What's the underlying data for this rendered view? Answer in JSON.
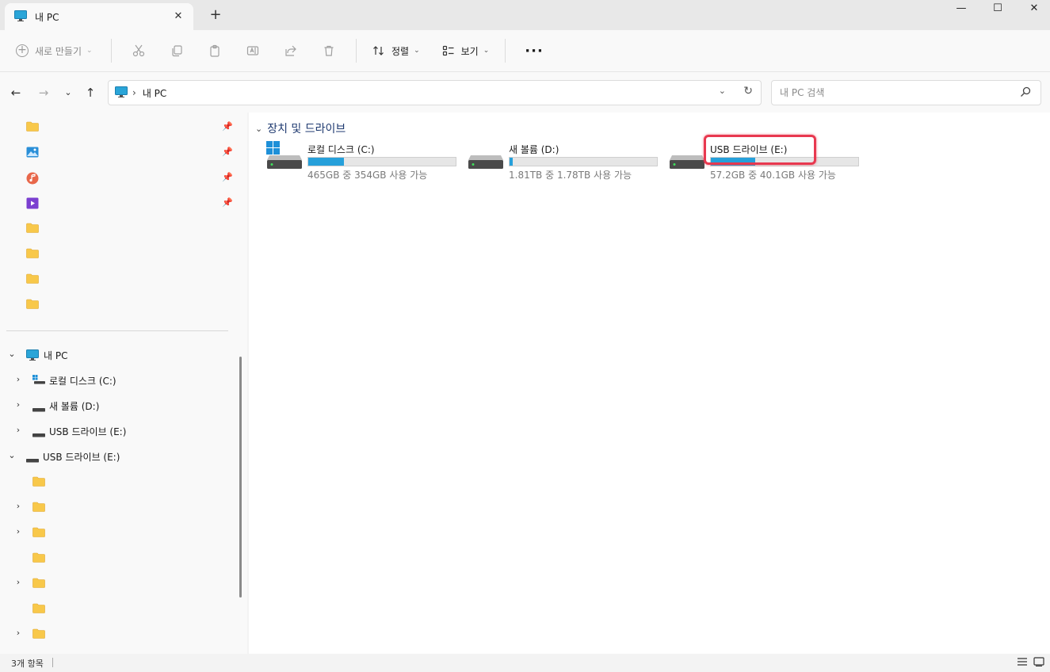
{
  "tab": {
    "title": "내 PC",
    "close_glyph": "✕",
    "new_tab_glyph": "+"
  },
  "window_controls": {
    "minimize": "—",
    "maximize": "☐",
    "close": "✕"
  },
  "toolbar": {
    "new_label": "새로 만들기",
    "sort_label": "정렬",
    "view_label": "보기",
    "more_label": "···"
  },
  "address": {
    "crumb": "내 PC",
    "search_placeholder": "내 PC 검색"
  },
  "sidebar": {
    "tree": {
      "this_pc": "내 PC",
      "local_disk_c": "로컬 디스크 (C:)",
      "new_volume_d": "새 볼륨 (D:)",
      "usb_e_child": "USB 드라이브 (E:)",
      "usb_e_root": "USB 드라이브 (E:)"
    }
  },
  "content": {
    "group_title": "장치 및 드라이브",
    "drives": [
      {
        "name": "로컬 디스크 (C:)",
        "free_text": "465GB 중 354GB 사용 가능",
        "used_fraction": 0.24
      },
      {
        "name": "새 볼륨 (D:)",
        "free_text": "1.81TB 중 1.78TB 사용 가능",
        "used_fraction": 0.02
      },
      {
        "name": "USB 드라이브 (E:)",
        "free_text": "57.2GB 중 40.1GB 사용 가능",
        "used_fraction": 0.3
      }
    ]
  },
  "status": {
    "item_count": "3개 항목"
  },
  "colors": {
    "accent": "#26a0da",
    "highlight": "#e8384f",
    "folder": "#f8c84a",
    "group_title": "#1f3a70"
  }
}
